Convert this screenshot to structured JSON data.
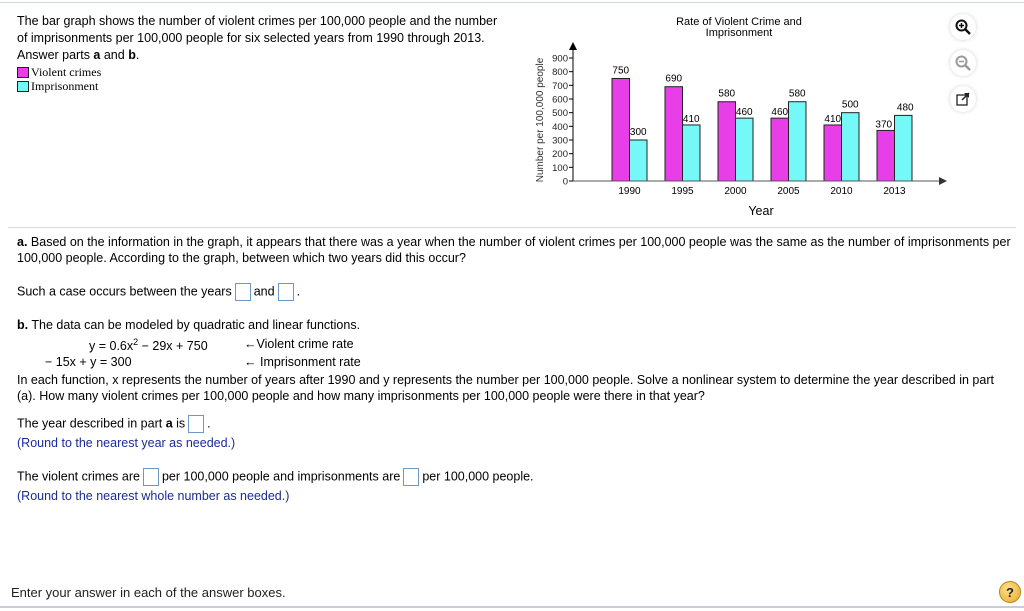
{
  "intro": {
    "text_before": "The bar graph shows the number of violent crimes per 100,000 people and the number of imprisonments per 100,000 people for six selected years from 1990 through 2013. Answer parts ",
    "part_a": "a",
    "and": " and ",
    "part_b": "b",
    "end": "."
  },
  "legend": [
    {
      "label": "Violent crimes",
      "color": "#e83ee8"
    },
    {
      "label": "Imprisonment",
      "color": "#74f8f8"
    }
  ],
  "tools": [
    {
      "name": "zoom-in-icon",
      "glyph": "+"
    },
    {
      "name": "zoom-out-icon",
      "glyph": "−"
    },
    {
      "name": "popout-icon",
      "glyph": "↗"
    }
  ],
  "chart_data": {
    "type": "bar",
    "title": "Rate of Violent Crime and Imprisonment",
    "title_lines": [
      "Rate of Violent Crime and",
      "Imprisonment"
    ],
    "xlabel": "Year",
    "ylabel": "Number per 100,000 people",
    "categories": [
      "1990",
      "1995",
      "2000",
      "2005",
      "2010",
      "2013"
    ],
    "series": [
      {
        "name": "Violent crimes",
        "color": "#e83ee8",
        "values": [
          750,
          690,
          580,
          460,
          410,
          370
        ]
      },
      {
        "name": "Imprisonment",
        "color": "#74f8f8",
        "values": [
          300,
          410,
          460,
          580,
          500,
          480
        ]
      }
    ],
    "yticks": [
      0,
      100,
      200,
      300,
      400,
      500,
      600,
      700,
      800,
      900
    ],
    "ylim": [
      0,
      900
    ],
    "grid": false,
    "legend": "top-left"
  },
  "part_a": {
    "label": "a.",
    "question": " Based on the information in the graph, it appears that there was a year when the number of violent crimes per 100,000 people was the same as the number of imprisonments per 100,000 people. According to the graph, between which two years did this occur?",
    "answer_prefix": "Such a case occurs between the years",
    "answer_mid": "and",
    "answer_end": ".",
    "year1_value": "",
    "year2_value": ""
  },
  "part_b": {
    "label": "b.",
    "intro": " The data can be modeled by quadratic and linear functions.",
    "eq1_a": "y = 0.6x",
    "eq1_exp": "2",
    "eq1_b": " − 29x + 750",
    "eq1_note": "←Violent crime rate",
    "eq2": "− 15x + y = 300",
    "eq2_note": "← Imprisonment rate",
    "desc": "In each function, x represents the number of years after 1990 and y represents the number per 100,000 people. Solve a nonlinear system to determine the year described in part (a). How many violent crimes per 100,000 people and how many imprisonments per 100,000 people were there in that year?",
    "year_prefix": "The year described in part ",
    "year_bold": "a",
    "year_mid": " is",
    "year_end": ".",
    "year_hint": "(Round to the nearest year as needed.)",
    "vc_prefix": "The violent crimes are",
    "vc_mid": "per 100,000 people and imprisonments are",
    "vc_end": "per 100,000 people.",
    "vc_hint": "(Round to the nearest whole number as needed.)",
    "year_value": "",
    "violent_value": "",
    "imprison_value": ""
  },
  "footer": {
    "instruction": "Enter your answer in each of the answer boxes.",
    "help_glyph": "?"
  }
}
